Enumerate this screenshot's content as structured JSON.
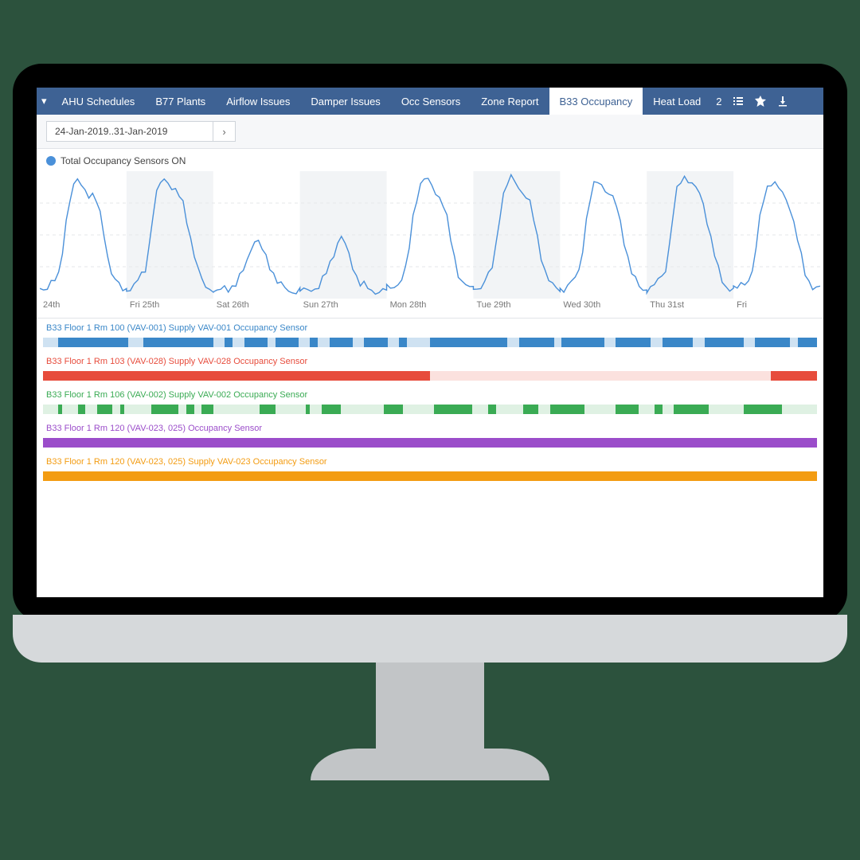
{
  "nav": {
    "dropdown_icon": "▾",
    "tabs": [
      {
        "label": "AHU Schedules",
        "active": false
      },
      {
        "label": "B77 Plants",
        "active": false
      },
      {
        "label": "Airflow Issues",
        "active": false
      },
      {
        "label": "Damper Issues",
        "active": false
      },
      {
        "label": "Occ Sensors",
        "active": false
      },
      {
        "label": "Zone Report",
        "active": false
      },
      {
        "label": "B33 Occupancy",
        "active": true
      },
      {
        "label": "Heat Load",
        "active": false
      }
    ],
    "overflow_count": "2"
  },
  "date_range": {
    "text": "24-Jan-2019..31-Jan-2019"
  },
  "chart": {
    "legend": "Total Occupancy Sensors ON"
  },
  "chart_data": {
    "type": "line",
    "title": "Total Occupancy Sensors ON",
    "x_ticks": [
      "24th",
      "Fri 25th",
      "Sat 26th",
      "Sun 27th",
      "Mon 28th",
      "Tue 29th",
      "Wed 30th",
      "Thu 31st",
      "Fri"
    ],
    "ylim": [
      0,
      100
    ],
    "series": [
      {
        "name": "Total Occupancy Sensors ON",
        "values_per_day_hourly": [
          [
            8,
            8,
            10,
            12,
            14,
            18,
            38,
            62,
            78,
            88,
            92,
            90,
            86,
            82,
            80,
            76,
            66,
            52,
            34,
            20,
            14,
            10,
            8,
            8
          ],
          [
            8,
            8,
            10,
            14,
            18,
            24,
            42,
            66,
            82,
            90,
            94,
            92,
            88,
            84,
            80,
            74,
            62,
            48,
            34,
            22,
            14,
            10,
            8,
            8
          ],
          [
            6,
            6,
            6,
            8,
            8,
            10,
            12,
            16,
            22,
            30,
            40,
            46,
            44,
            38,
            32,
            26,
            20,
            14,
            10,
            8,
            6,
            6,
            6,
            6
          ],
          [
            6,
            6,
            6,
            8,
            8,
            10,
            14,
            20,
            28,
            36,
            44,
            48,
            42,
            34,
            26,
            18,
            12,
            10,
            8,
            6,
            6,
            6,
            6,
            6
          ],
          [
            8,
            8,
            10,
            12,
            16,
            22,
            40,
            64,
            80,
            90,
            94,
            92,
            88,
            84,
            80,
            74,
            62,
            46,
            32,
            20,
            14,
            10,
            8,
            8
          ],
          [
            8,
            8,
            10,
            14,
            18,
            24,
            42,
            66,
            82,
            90,
            94,
            92,
            88,
            84,
            80,
            74,
            62,
            48,
            34,
            22,
            14,
            10,
            8,
            8
          ],
          [
            8,
            8,
            10,
            12,
            16,
            22,
            40,
            62,
            78,
            88,
            92,
            90,
            86,
            82,
            78,
            72,
            60,
            46,
            32,
            20,
            14,
            10,
            8,
            8
          ],
          [
            8,
            8,
            10,
            14,
            18,
            24,
            42,
            66,
            84,
            92,
            96,
            94,
            90,
            86,
            82,
            74,
            62,
            48,
            34,
            22,
            14,
            10,
            8,
            8
          ],
          [
            8,
            8,
            10,
            12,
            16,
            22,
            40,
            62,
            78,
            88,
            92,
            90,
            86,
            82,
            78,
            72,
            60,
            46,
            32,
            20,
            14,
            10,
            8,
            8
          ]
        ]
      }
    ],
    "grid": true
  },
  "lanes": [
    {
      "label": "B33 Floor 1 Rm 100 (VAV-001) Supply VAV-001 Occupancy Sensor",
      "color": "#3a87c8",
      "light": "#cfe2f2",
      "segments": [
        [
          0.02,
          0.11
        ],
        [
          0.13,
          0.22
        ],
        [
          0.235,
          0.245
        ],
        [
          0.26,
          0.29
        ],
        [
          0.3,
          0.33
        ],
        [
          0.345,
          0.355
        ],
        [
          0.37,
          0.4
        ],
        [
          0.415,
          0.445
        ],
        [
          0.46,
          0.47
        ],
        [
          0.5,
          0.6
        ],
        [
          0.615,
          0.66
        ],
        [
          0.67,
          0.725
        ],
        [
          0.74,
          0.785
        ],
        [
          0.8,
          0.84
        ],
        [
          0.855,
          0.905
        ],
        [
          0.92,
          0.965
        ],
        [
          0.975,
          1.0
        ]
      ]
    },
    {
      "label": "B33 Floor 1 Rm 103 (VAV-028) Supply VAV-028 Occupancy Sensor",
      "color": "#e74c3c",
      "light": "#fbe1de",
      "segments": [
        [
          0.0,
          0.5
        ],
        [
          0.94,
          1.0
        ]
      ]
    },
    {
      "label": "B33 Floor 1 Rm 106 (VAV-002) Supply VAV-002 Occupancy Sensor",
      "color": "#3aab54",
      "light": "#dff1e3",
      "segments": [
        [
          0.02,
          0.025
        ],
        [
          0.045,
          0.055
        ],
        [
          0.07,
          0.09
        ],
        [
          0.1,
          0.105
        ],
        [
          0.14,
          0.175
        ],
        [
          0.185,
          0.195
        ],
        [
          0.205,
          0.22
        ],
        [
          0.28,
          0.3
        ],
        [
          0.34,
          0.345
        ],
        [
          0.36,
          0.385
        ],
        [
          0.44,
          0.465
        ],
        [
          0.505,
          0.555
        ],
        [
          0.575,
          0.585
        ],
        [
          0.62,
          0.64
        ],
        [
          0.655,
          0.7
        ],
        [
          0.74,
          0.77
        ],
        [
          0.79,
          0.8
        ],
        [
          0.815,
          0.86
        ],
        [
          0.905,
          0.955
        ]
      ]
    },
    {
      "label": "B33 Floor 1 Rm 120 (VAV-023, 025) Occupancy Sensor",
      "color": "#9b4dca",
      "light": "#9b4dca",
      "segments": [
        [
          0.0,
          1.0
        ]
      ]
    },
    {
      "label": "B33 Floor 1 Rm 120 (VAV-023, 025) Supply VAV-023 Occupancy Sensor",
      "color": "#f39c12",
      "light": "#f39c12",
      "segments": [
        [
          0.0,
          1.0
        ]
      ]
    }
  ]
}
